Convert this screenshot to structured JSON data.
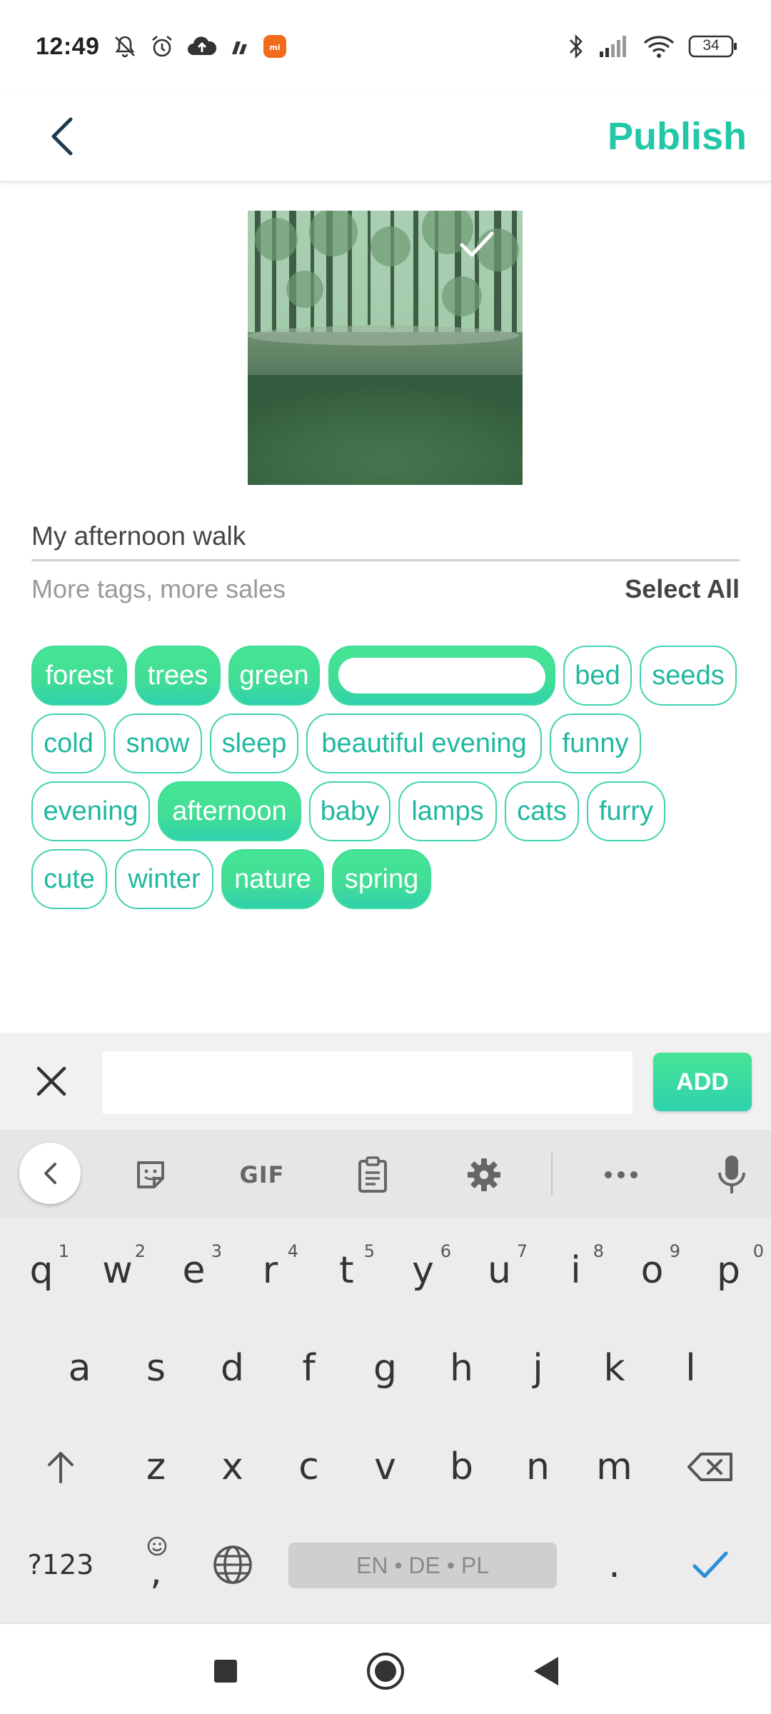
{
  "status_bar": {
    "time": "12:49",
    "battery": "34",
    "icons": [
      "mute-icon",
      "alarm-icon",
      "upload-icon",
      "sim-icon",
      "mi-icon",
      "bluetooth-icon",
      "signal-icon",
      "wifi-icon",
      "battery-icon"
    ]
  },
  "header": {
    "back_icon": "chevron-left-icon",
    "publish_label": "Publish"
  },
  "photo": {
    "description_icon": "check-icon"
  },
  "form": {
    "title_value": "My afternoon walk",
    "tags_hint": "More tags, more sales",
    "select_all_label": "Select All"
  },
  "tags": [
    {
      "label": "forest",
      "selected": true
    },
    {
      "label": "trees",
      "selected": true
    },
    {
      "label": "green",
      "selected": true
    },
    {
      "label": "",
      "selected": true
    },
    {
      "label": "bed",
      "selected": false
    },
    {
      "label": "seeds",
      "selected": false
    },
    {
      "label": "cold",
      "selected": false
    },
    {
      "label": "snow",
      "selected": false
    },
    {
      "label": "sleep",
      "selected": false
    },
    {
      "label": "beautiful evening",
      "selected": false
    },
    {
      "label": "funny",
      "selected": false
    },
    {
      "label": "evening",
      "selected": false
    },
    {
      "label": "afternoon",
      "selected": true
    },
    {
      "label": "baby",
      "selected": false
    },
    {
      "label": "lamps",
      "selected": false
    },
    {
      "label": "cats",
      "selected": false
    },
    {
      "label": "furry",
      "selected": false
    },
    {
      "label": "cute",
      "selected": false
    },
    {
      "label": "winter",
      "selected": false
    },
    {
      "label": "nature",
      "selected": true
    },
    {
      "label": "spring",
      "selected": true
    }
  ],
  "input_bar": {
    "tag_input_value": "",
    "add_label": "ADD"
  },
  "keyboard_toolbar": {
    "gif_label": "GIF",
    "tools": [
      "collapse-icon",
      "sticker-icon",
      "gif-icon",
      "clipboard-icon",
      "settings-icon",
      "more-icon",
      "microphone-icon"
    ]
  },
  "keyboard": {
    "row1": [
      {
        "k": "q",
        "n": "1"
      },
      {
        "k": "w",
        "n": "2"
      },
      {
        "k": "e",
        "n": "3"
      },
      {
        "k": "r",
        "n": "4"
      },
      {
        "k": "t",
        "n": "5"
      },
      {
        "k": "y",
        "n": "6"
      },
      {
        "k": "u",
        "n": "7"
      },
      {
        "k": "i",
        "n": "8"
      },
      {
        "k": "o",
        "n": "9"
      },
      {
        "k": "p",
        "n": "0"
      }
    ],
    "row2": [
      "a",
      "s",
      "d",
      "f",
      "g",
      "h",
      "j",
      "k",
      "l"
    ],
    "row3": [
      "z",
      "x",
      "c",
      "v",
      "b",
      "n",
      "m"
    ],
    "symbols_label": "?123",
    "comma_label": ",",
    "space_label": "EN • DE • PL",
    "period_label": "."
  },
  "colors": {
    "accent": "#21c7a6",
    "tag_selected": "#41dd96",
    "tag_border": "#3fd3b0"
  }
}
